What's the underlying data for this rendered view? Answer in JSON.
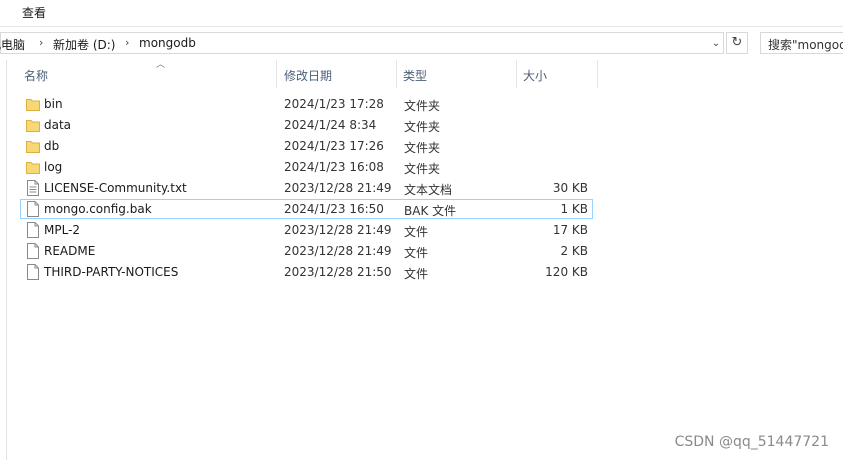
{
  "ribbon": {
    "tab_view": "查看"
  },
  "address": {
    "crumbs": [
      "此电脑",
      "新加卷 (D:)",
      "mongodb"
    ],
    "search_placeholder": "搜索\"mongodb\""
  },
  "columns": {
    "name": "名称",
    "date": "修改日期",
    "type": "类型",
    "size": "大小"
  },
  "files": [
    {
      "name": "bin",
      "date": "2024/1/23 17:28",
      "type": "文件夹",
      "size": "",
      "icon": "folder-icon"
    },
    {
      "name": "data",
      "date": "2024/1/24 8:34",
      "type": "文件夹",
      "size": "",
      "icon": "folder-icon"
    },
    {
      "name": "db",
      "date": "2024/1/23 17:26",
      "type": "文件夹",
      "size": "",
      "icon": "folder-icon"
    },
    {
      "name": "log",
      "date": "2024/1/23 16:08",
      "type": "文件夹",
      "size": "",
      "icon": "folder-icon"
    },
    {
      "name": "LICENSE-Community.txt",
      "date": "2023/12/28 21:49",
      "type": "文本文档",
      "size": "30 KB",
      "icon": "text-file-icon"
    },
    {
      "name": "mongo.config.bak",
      "date": "2024/1/23 16:50",
      "type": "BAK 文件",
      "size": "1 KB",
      "icon": "file-icon",
      "selected": true
    },
    {
      "name": "MPL-2",
      "date": "2023/12/28 21:49",
      "type": "文件",
      "size": "17 KB",
      "icon": "file-icon"
    },
    {
      "name": "README",
      "date": "2023/12/28 21:49",
      "type": "文件",
      "size": "2 KB",
      "icon": "file-icon"
    },
    {
      "name": "THIRD-PARTY-NOTICES",
      "date": "2023/12/28 21:50",
      "type": "文件",
      "size": "120 KB",
      "icon": "file-icon"
    }
  ],
  "watermark": "CSDN @qq_51447721",
  "colors": {
    "folder": "#f8d775",
    "selection_border": "#99d1ff",
    "header_text": "#4c607a"
  }
}
